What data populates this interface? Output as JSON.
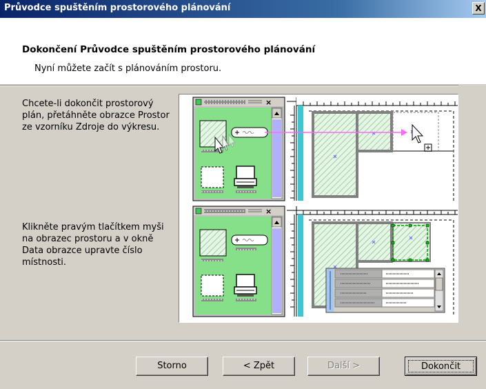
{
  "window": {
    "title": "Průvodce spuštěním prostorového plánování",
    "close_label": "X"
  },
  "header": {
    "heading": "Dokončení Průvodce spuštěním prostorového plánování",
    "subtitle": "Nyní můžete začít s plánováním prostoru."
  },
  "instructions": [
    "Chcete-li dokončit prostorový plán, přetáhněte obrazce Prostor ze vzorníku Zdroje do výkresu.",
    "Klikněte pravým tlačítkem myši na obrazec prostoru a v okně Data obrazce upravte číslo místnosti."
  ],
  "buttons": {
    "cancel": "Storno",
    "back": "< Zpět",
    "next": "Další >",
    "finish": "Dokončit"
  },
  "colors": {
    "titlebar_start": "#0a246a",
    "stencil_green": "#86e08a",
    "drag_arrow": "#ff66ff",
    "selection_green": "#00a000"
  }
}
